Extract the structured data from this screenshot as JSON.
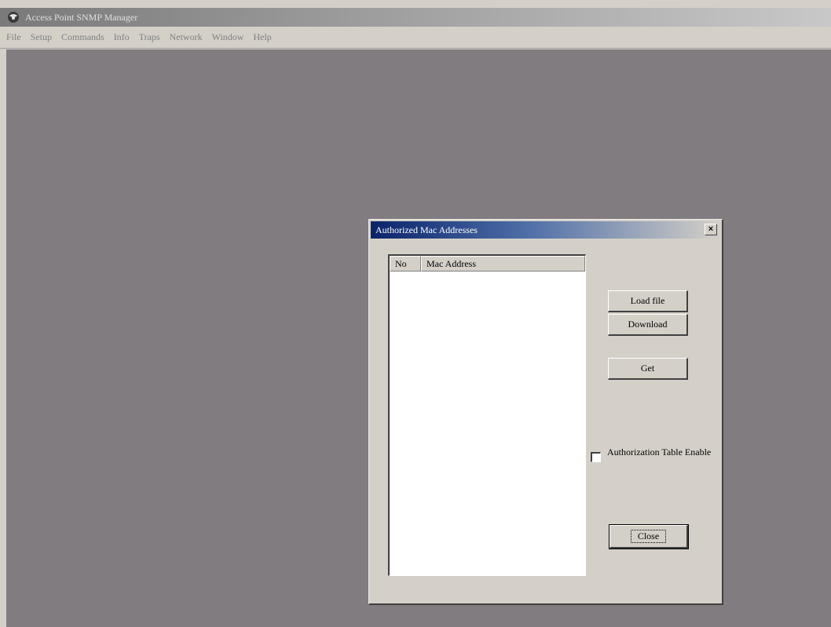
{
  "app": {
    "title": "Access Point SNMP Manager",
    "icon": "app-logo-icon"
  },
  "menu": {
    "items": [
      "File",
      "Setup",
      "Commands",
      "Info",
      "Traps",
      "Network",
      "Window",
      "Help"
    ]
  },
  "dialog": {
    "title": "Authorized Mac Addresses",
    "close_glyph": "×",
    "list": {
      "columns": [
        "No",
        "Mac Address"
      ],
      "rows": []
    },
    "buttons": {
      "load": "Load file",
      "download": "Download",
      "get": "Get",
      "close": "Close"
    },
    "checkbox": {
      "label": "Authorization Table Enable",
      "checked": false
    }
  },
  "colors": {
    "desktop": "#807c80",
    "dialog_title_start": "#0a246a",
    "face": "#d4d0c8"
  }
}
